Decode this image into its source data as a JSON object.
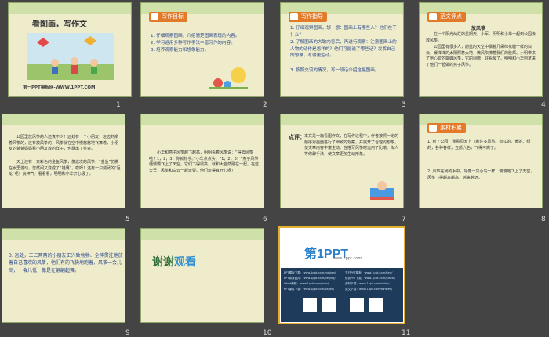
{
  "slides": [
    {
      "num": "1",
      "title": "看图画，写作文",
      "footer": "第一PPT模板网-WWW.1PPT.COM"
    },
    {
      "num": "2",
      "tag": "写作目标",
      "items": [
        "1. 仔细观察图画，介绍清楚图画表现的内容。",
        "2. 学习运用多种写作手法丰富习作的内容。",
        "3. 培养观察能力和想象能力。"
      ]
    },
    {
      "num": "3",
      "tag": "写作指导",
      "items": [
        "1. 仔细观察图画，想一想：图画上有哪些人？他们在干什么？",
        "2. 了解图画的大致内容后，再进行观察：注意图画上的人物的动作是怎样的？他们可能说了哪些话？发挥自己的想象，写得更生动。",
        "3. 按照交流的情况，写一段话介绍这幅图画。"
      ]
    },
    {
      "num": "4",
      "tag": "范文评点",
      "title": "放风筝",
      "paras": [
        "在一个阳光灿烂的星期天，小军、明明和小华一起到公园去放风筝。",
        "公园里有很多人，蔚蓝的天空中飘着几朵绵花糖一样的白云，暖洋洋的太阳照着大地，微风吹拂着我们的脸颊。小明带来了她心爱的蝴蝶风筝，它的翅膀，好看极了。明明和小华则拿来了他们一起做的燕子风筝。"
      ]
    },
    {
      "num": "5",
      "paras": [
        "公园里放风筝的人还真不少！远处有一个小朋友，左边的拿着风筝的，还有放风筝的，风筝就在空中慢悠悠地飞舞着，小朋友的爸爸妈妈看小朋友放的样子，也露出了笑容。",
        "天上还有一只彩色的金鱼风筝，像这次的风筝，“金鱼”仿佛在水里游动，忽然间又变成了“雄鹰”，哎呀！还有一只威武的“巨龙”呢！真神气！看看看，明明和小华开心极了。"
      ]
    },
    {
      "num": "6",
      "paras": [
        "小华和燕子风筝越飞越高，明明看着风筝说：“得去风筝啦！1，2，3，你就松手。”小华点点头：“1，2，3！”燕子风筝便慢慢飞上了天空。它们飞得很高，就和大自然融在一起。在蓝天里，风筝和白云一起玩耍。他们玩得真开心呀！"
      ]
    },
    {
      "num": "7",
      "label": "点评：",
      "body": "本文是一篇看图作文，在写作过程中，作者按照一定的顺序对画面进行了细致的观察，并展开了合理的想象，使文章内容丰富生动。在描写风筝时运用了比喻、拟人等修辞手法，使文章更加生动形象。"
    },
    {
      "num": "8",
      "tag": "素材积累",
      "paras": [
        "1. 到了公园，我看见天上飞着许多风筝。有红的、黄的、绿的，各种各样，五颜六色，飞得可高了。",
        "2. 风筝在我的手中，好像一只小鸟一样，慢慢地飞上了天空。风筝飞得越来越高，越来越远。"
      ]
    },
    {
      "num": "9",
      "items": [
        "3. 远处，三三两两的小朋友正兴致勃勃、全神贯注地放着自己喜欢的风筝，他们有的飞快地跑着，风筝一会儿高，一会儿低，像是在翩翩起舞。"
      ]
    },
    {
      "num": "10",
      "thanks1": "谢谢",
      "thanks2": "观看"
    },
    {
      "num": "11",
      "logo": "第1PPT",
      "logo_url": "www.1ppt.com",
      "line1": "PPT模板下载：www.1ppt.com/moban/",
      "line2": "节日PPT模板：www.1ppt.com/jieri/",
      "line3": "PPT背景图片：www.1ppt.com/beijing/",
      "line4": "优秀PPT下载：www.1ppt.com/xiazai/",
      "line5": "Word教程：www.1ppt.com/word/",
      "line6": "资料下载：www.1ppt.com/ziliao/",
      "line7": "PPT课件下载：www.1ppt.com/kejian/",
      "line8": "范文下载：www.1ppt.com/fanwen/"
    }
  ]
}
